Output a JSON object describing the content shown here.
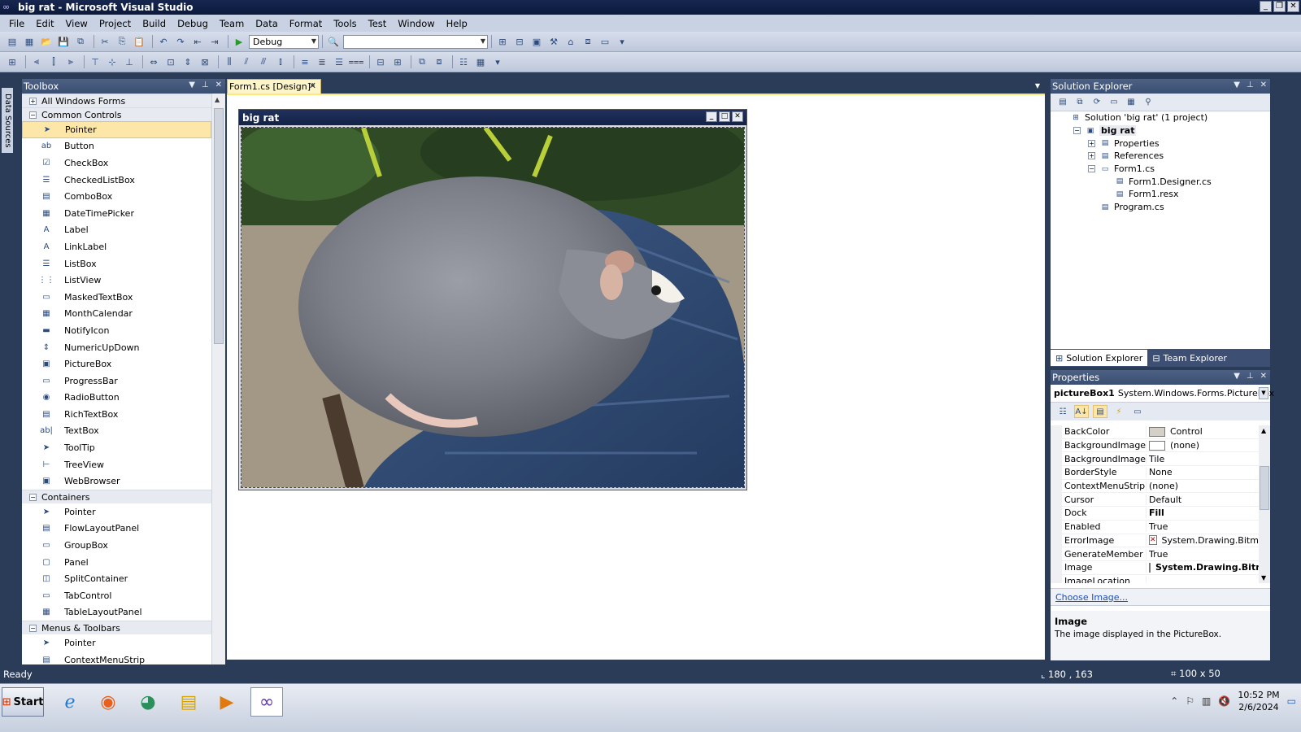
{
  "window": {
    "title": "big rat - Microsoft Visual Studio"
  },
  "menu": [
    "File",
    "Edit",
    "View",
    "Project",
    "Build",
    "Debug",
    "Team",
    "Data",
    "Format",
    "Tools",
    "Test",
    "Window",
    "Help"
  ],
  "toolbar": {
    "config_value": "Debug",
    "platform_value": ""
  },
  "side_strip": {
    "label": "Data Sources"
  },
  "toolbox": {
    "title": "Toolbox",
    "categories": [
      {
        "label": "All Windows Forms",
        "expander": "+",
        "items": []
      },
      {
        "label": "Common Controls",
        "expander": "−",
        "items": [
          {
            "label": "Pointer",
            "icon": "pointer-icon",
            "glyph": "➤"
          },
          {
            "label": "Button",
            "icon": "button-icon",
            "glyph": "ab"
          },
          {
            "label": "CheckBox",
            "icon": "checkbox-icon",
            "glyph": "☑"
          },
          {
            "label": "CheckedListBox",
            "icon": "checkedlistbox-icon",
            "glyph": "☰"
          },
          {
            "label": "ComboBox",
            "icon": "combobox-icon",
            "glyph": "▤"
          },
          {
            "label": "DateTimePicker",
            "icon": "datetimepicker-icon",
            "glyph": "▦"
          },
          {
            "label": "Label",
            "icon": "label-icon",
            "glyph": "A"
          },
          {
            "label": "LinkLabel",
            "icon": "linklabel-icon",
            "glyph": "A"
          },
          {
            "label": "ListBox",
            "icon": "listbox-icon",
            "glyph": "☰"
          },
          {
            "label": "ListView",
            "icon": "listview-icon",
            "glyph": "⋮⋮"
          },
          {
            "label": "MaskedTextBox",
            "icon": "maskedtextbox-icon",
            "glyph": "▭"
          },
          {
            "label": "MonthCalendar",
            "icon": "monthcalendar-icon",
            "glyph": "▦"
          },
          {
            "label": "NotifyIcon",
            "icon": "notifyicon-icon",
            "glyph": "▬"
          },
          {
            "label": "NumericUpDown",
            "icon": "numericupdown-icon",
            "glyph": "⇕"
          },
          {
            "label": "PictureBox",
            "icon": "picturebox-icon",
            "glyph": "▣"
          },
          {
            "label": "ProgressBar",
            "icon": "progressbar-icon",
            "glyph": "▭"
          },
          {
            "label": "RadioButton",
            "icon": "radiobutton-icon",
            "glyph": "◉"
          },
          {
            "label": "RichTextBox",
            "icon": "richtextbox-icon",
            "glyph": "▤"
          },
          {
            "label": "TextBox",
            "icon": "textbox-icon",
            "glyph": "ab|"
          },
          {
            "label": "ToolTip",
            "icon": "tooltip-icon",
            "glyph": "➤"
          },
          {
            "label": "TreeView",
            "icon": "treeview-icon",
            "glyph": "⊢"
          },
          {
            "label": "WebBrowser",
            "icon": "webbrowser-icon",
            "glyph": "▣"
          }
        ]
      },
      {
        "label": "Containers",
        "expander": "−",
        "items": [
          {
            "label": "Pointer",
            "icon": "pointer-icon",
            "glyph": "➤"
          },
          {
            "label": "FlowLayoutPanel",
            "icon": "flowlayoutpanel-icon",
            "glyph": "▤"
          },
          {
            "label": "GroupBox",
            "icon": "groupbox-icon",
            "glyph": "▭"
          },
          {
            "label": "Panel",
            "icon": "panel-icon",
            "glyph": "▢"
          },
          {
            "label": "SplitContainer",
            "icon": "splitcontainer-icon",
            "glyph": "◫"
          },
          {
            "label": "TabControl",
            "icon": "tabcontrol-icon",
            "glyph": "▭"
          },
          {
            "label": "TableLayoutPanel",
            "icon": "tablelayoutpanel-icon",
            "glyph": "▦"
          }
        ]
      },
      {
        "label": "Menus & Toolbars",
        "expander": "−",
        "items": [
          {
            "label": "Pointer",
            "icon": "pointer-icon",
            "glyph": "➤"
          },
          {
            "label": "ContextMenuStrip",
            "icon": "contextmenustrip-icon",
            "glyph": "▤"
          }
        ]
      }
    ]
  },
  "document": {
    "tab_label": "Form1.cs [Design]*",
    "form_title": "big rat"
  },
  "solution_explorer": {
    "title": "Solution Explorer",
    "nodes": [
      {
        "label": "Solution 'big rat' (1 project)",
        "level": 0,
        "expander": "",
        "bold": false,
        "icon": "solution-icon"
      },
      {
        "label": "big rat",
        "level": 1,
        "expander": "−",
        "bold": true,
        "icon": "project-icon"
      },
      {
        "label": "Properties",
        "level": 2,
        "expander": "+",
        "bold": false,
        "icon": "properties-folder-icon"
      },
      {
        "label": "References",
        "level": 2,
        "expander": "+",
        "bold": false,
        "icon": "references-folder-icon"
      },
      {
        "label": "Form1.cs",
        "level": 2,
        "expander": "−",
        "bold": false,
        "icon": "form-file-icon"
      },
      {
        "label": "Form1.Designer.cs",
        "level": 3,
        "expander": "",
        "bold": false,
        "icon": "cs-file-icon"
      },
      {
        "label": "Form1.resx",
        "level": 3,
        "expander": "",
        "bold": false,
        "icon": "resx-file-icon"
      },
      {
        "label": "Program.cs",
        "level": 2,
        "expander": "",
        "bold": false,
        "icon": "cs-file-icon"
      }
    ],
    "tabs": [
      "Solution Explorer",
      "Team Explorer"
    ]
  },
  "properties": {
    "title": "Properties",
    "object_name": "pictureBox1",
    "object_type": "System.Windows.Forms.PictureBox",
    "rows": [
      {
        "name": "BackColor",
        "value": "Control",
        "swatch": "#d4d0c8",
        "bold": false,
        "expander": ""
      },
      {
        "name": "BackgroundImage",
        "value": "(none)",
        "swatch": "#ffffff",
        "bold": false,
        "expander": ""
      },
      {
        "name": "BackgroundImageLayout",
        "value": "Tile",
        "swatch": "",
        "bold": false,
        "expander": ""
      },
      {
        "name": "BorderStyle",
        "value": "None",
        "swatch": "",
        "bold": false,
        "expander": ""
      },
      {
        "name": "ContextMenuStrip",
        "value": "(none)",
        "swatch": "",
        "bold": false,
        "expander": ""
      },
      {
        "name": "Cursor",
        "value": "Default",
        "swatch": "",
        "bold": false,
        "expander": ""
      },
      {
        "name": "Dock",
        "value": "Fill",
        "swatch": "",
        "bold": true,
        "expander": ""
      },
      {
        "name": "Enabled",
        "value": "True",
        "swatch": "",
        "bold": false,
        "expander": ""
      },
      {
        "name": "ErrorImage",
        "value": "System.Drawing.Bitmap",
        "swatch": "err",
        "bold": false,
        "expander": "+"
      },
      {
        "name": "GenerateMember",
        "value": "True",
        "swatch": "",
        "bold": false,
        "expander": ""
      },
      {
        "name": "Image",
        "value": "System.Drawing.Bitmap",
        "swatch": "img",
        "bold": true,
        "expander": "+"
      },
      {
        "name": "ImageLocation",
        "value": "",
        "swatch": "",
        "bold": false,
        "expander": ""
      }
    ],
    "verb_link": "Choose Image...",
    "desc_title": "Image",
    "desc_text": "The image displayed in the PictureBox."
  },
  "status": {
    "text": "Ready",
    "coords": "180 , 163",
    "size": "100 x 50"
  },
  "taskbar": {
    "start_label": "Start",
    "time": "10:52 PM",
    "date": "2/6/2024"
  }
}
